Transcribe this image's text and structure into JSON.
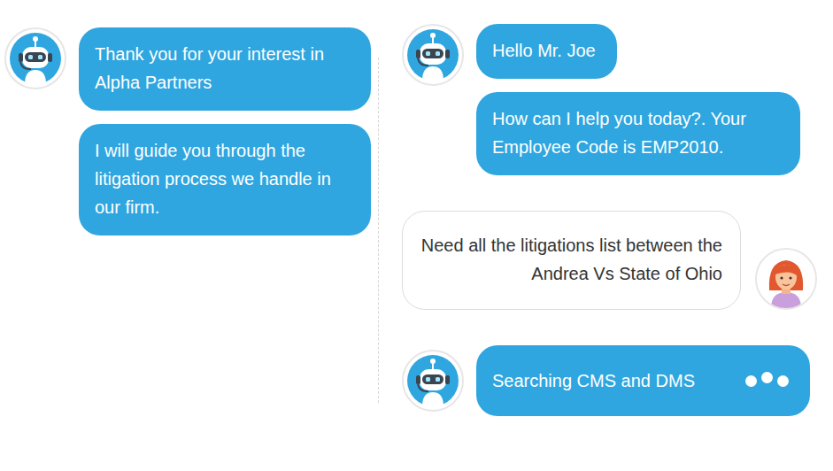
{
  "panels": [
    {
      "messages": [
        {
          "kind": "bot",
          "texts": [
            "Thank you for your interest in Alpha Partners",
            "I will guide you through the litigation process we handle in our firm."
          ],
          "typing": false
        }
      ]
    },
    {
      "messages": [
        {
          "kind": "bot",
          "texts": [
            "Hello Mr. Joe",
            "How can I help you today?. Your Employee Code is EMP2010."
          ],
          "typing": false
        },
        {
          "kind": "user",
          "texts": [
            "Need all the litigations list between the Andrea Vs State of Ohio"
          ],
          "typing": false
        },
        {
          "kind": "bot",
          "texts": [
            "Searching CMS and DMS"
          ],
          "typing": true
        }
      ]
    }
  ]
}
